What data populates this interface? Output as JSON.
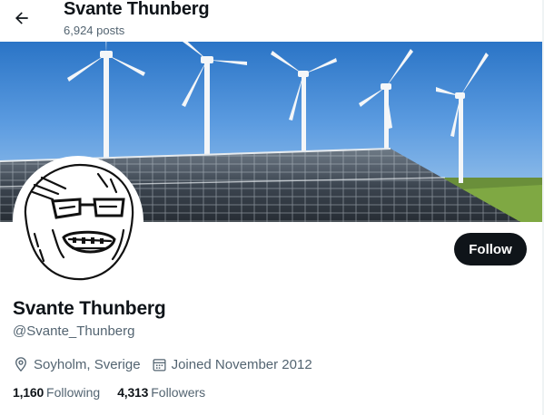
{
  "header": {
    "back_icon": "arrow-left-icon",
    "title": "Svante Thunberg",
    "post_count": "6,924 posts"
  },
  "banner": {
    "description_icon": "wind-turbines-solar-panels-image"
  },
  "profile": {
    "avatar_icon": "laughing-meme-face-avatar",
    "follow_label": "Follow",
    "display_name": "Svante Thunberg",
    "handle": "@Svante_Thunberg",
    "location_icon": "location-pin-icon",
    "location": "Soyholm, Sverige",
    "joined_icon": "calendar-icon",
    "joined": "Joined November 2012",
    "following_count": "1,160",
    "following_label": "Following",
    "followers_count": "4,313",
    "followers_label": "Followers"
  },
  "colors": {
    "text_primary": "#0f1419",
    "text_secondary": "#536471",
    "button_bg": "#0f1419",
    "button_text": "#ffffff"
  }
}
